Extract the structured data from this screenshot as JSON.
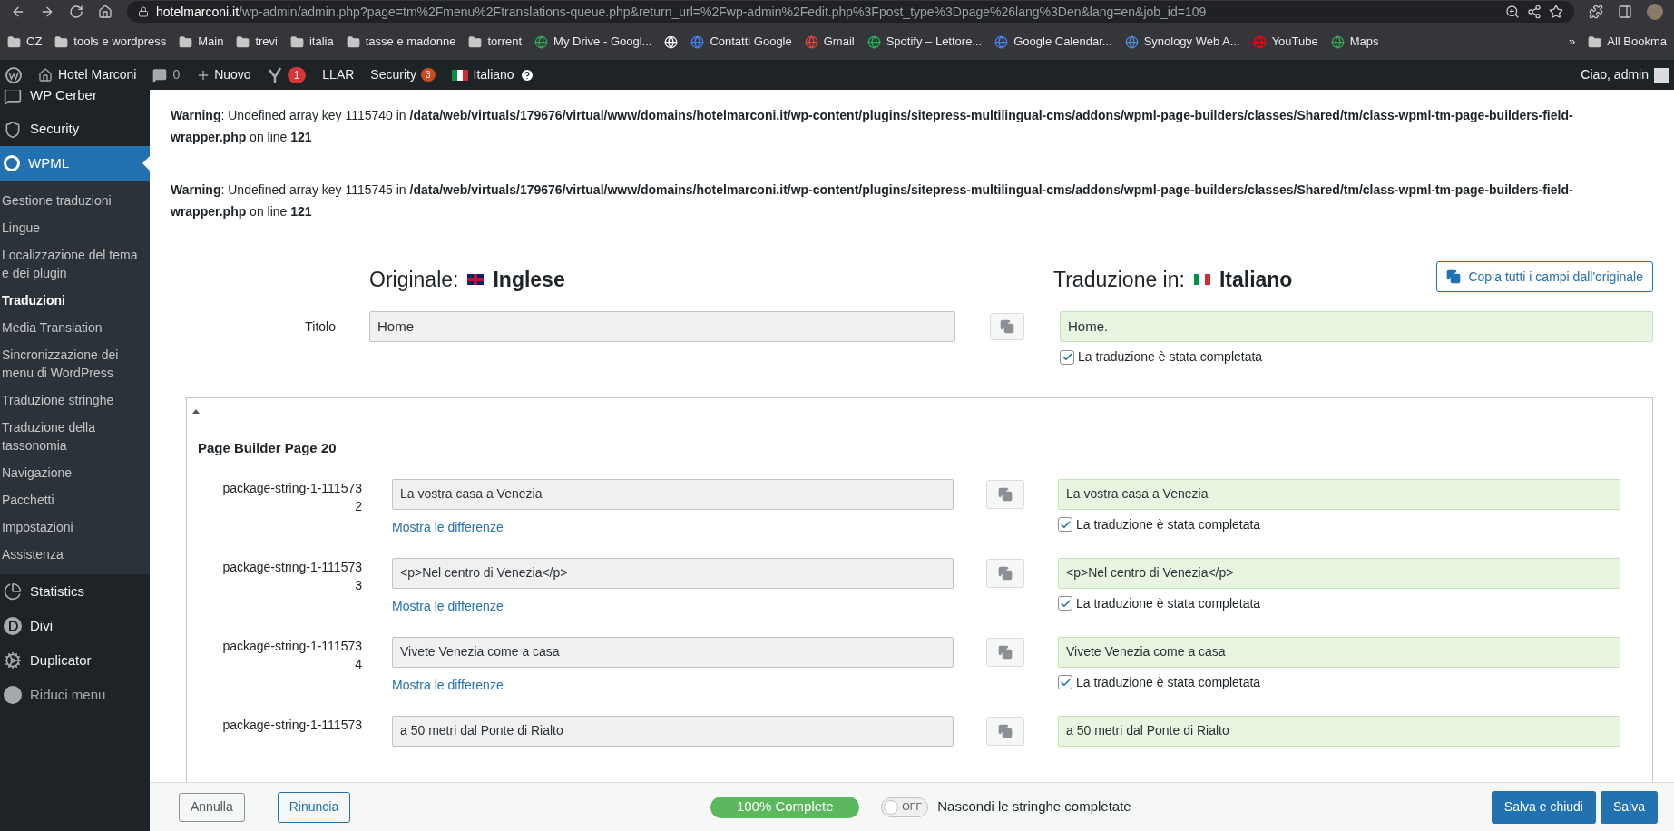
{
  "browser": {
    "url_host": "hotelmarconi.it",
    "url_path": "/wp-admin/admin.php?page=tm%2Fmenu%2Ftranslations-queue.php&return_url=%2Fwp-admin%2Fedit.php%3Fpost_type%3Dpage%26lang%3Den&lang=en&job_id=109"
  },
  "bookmarks": [
    {
      "kind": "folder",
      "label": "CZ"
    },
    {
      "kind": "folder",
      "label": "tools e wordpress"
    },
    {
      "kind": "folder",
      "label": "Main"
    },
    {
      "kind": "folder",
      "label": "trevi"
    },
    {
      "kind": "folder",
      "label": "italia"
    },
    {
      "kind": "folder",
      "label": "tasse e madonne"
    },
    {
      "kind": "folder",
      "label": "torrent"
    },
    {
      "kind": "site",
      "label": "My Drive - Googl...",
      "color": "#34a853"
    },
    {
      "kind": "site",
      "color": "#ffffff"
    },
    {
      "kind": "site",
      "label": "Contatti Google",
      "color": "#4285f4"
    },
    {
      "kind": "site",
      "label": "Gmail",
      "color": "#ea4335"
    },
    {
      "kind": "site",
      "label": "Spotify – Lettore...",
      "color": "#1db954"
    },
    {
      "kind": "site",
      "label": "Google Calendar...",
      "color": "#4285f4"
    },
    {
      "kind": "site",
      "label": "Synology Web A...",
      "color": "#4a90d9"
    },
    {
      "kind": "site",
      "label": "YouTube",
      "color": "#ff0000"
    },
    {
      "kind": "site",
      "label": "Maps",
      "color": "#34a853"
    }
  ],
  "bookmarks_more": "»",
  "bookmarks_all": "All Bookma",
  "admin_bar": {
    "site": "Hotel Marconi",
    "comments": "0",
    "new": "Nuovo",
    "yoast_badge": "1",
    "llar": "LLAR",
    "security": "Security",
    "security_badge": "3",
    "language": "Italiano",
    "greeting": "Ciao, admin"
  },
  "sidebar": {
    "top_items": [
      {
        "label": "WP Cerber"
      },
      {
        "label": "Security"
      }
    ],
    "current": {
      "label": "WPML",
      "selected": true
    },
    "submenu": [
      {
        "label": "Gestione traduzioni",
        "selected": false
      },
      {
        "label": "Lingue",
        "selected": false
      },
      {
        "label": "Localizzazione del tema e dei plugin",
        "selected": false
      },
      {
        "label": "Traduzioni",
        "selected": true
      },
      {
        "label": "Media Translation",
        "selected": false
      },
      {
        "label": "Sincronizzazione dei menu di WordPress",
        "selected": false
      },
      {
        "label": "Traduzione stringhe",
        "selected": false
      },
      {
        "label": "Traduzione della tassonomia",
        "selected": false
      },
      {
        "label": "Navigazione",
        "selected": false
      },
      {
        "label": "Pacchetti",
        "selected": false
      },
      {
        "label": "Impostazioni",
        "selected": false
      },
      {
        "label": "Assistenza",
        "selected": false
      }
    ],
    "bottom_items": [
      {
        "label": "Statistics"
      },
      {
        "label": "Divi"
      },
      {
        "label": "Duplicator"
      },
      {
        "label": "Riduci menu"
      }
    ]
  },
  "warnings": [
    {
      "text": "**Warning**: Undefined array key 1115740 in **/data/web/virtuals/179676/virtual/www/domains/hotelmarconi.it/wp-content/plugins/sitepress-multilingual-cms/addons/wpml-page-builders/classes/Shared/tm/class-wpml-tm-page-builders-field-wrapper.php** on line **121**"
    },
    {
      "text": "**Warning**: Undefined array key 1115745 in **/data/web/virtuals/179676/virtual/www/domains/hotelmarconi.it/wp-content/plugins/sitepress-multilingual-cms/addons/wpml-page-builders/classes/Shared/tm/class-wpml-tm-page-builders-field-wrapper.php** on line **121**"
    }
  ],
  "editor": {
    "original_label": "Originale:",
    "original_language": "Inglese",
    "translation_label": "Traduzione in:",
    "translation_language": "Italiano",
    "copy_all": "Copia tutti i campi dall'originale",
    "title_row": {
      "label": "Titolo",
      "original": "Home",
      "translation": "Home.",
      "completed": true,
      "completed_label": "La traduzione è stata completata"
    },
    "section": {
      "expanded": true,
      "title": "Page Builder Page 20",
      "rows": [
        {
          "label_lines": [
            "package-string-1-111573",
            "2"
          ],
          "original": "La vostra casa a Venezia",
          "diff_link": "Mostra le differenze",
          "translation": "La vostra casa a Venezia",
          "completed": true,
          "completed_label": "La traduzione è stata completata"
        },
        {
          "label_lines": [
            "package-string-1-111573",
            "3"
          ],
          "original": "<p>Nel centro di Venezia</p>",
          "diff_link": "Mostra le differenze",
          "translation": "<p>Nel centro di Venezia</p>",
          "completed": true,
          "completed_label": "La traduzione è stata completata"
        },
        {
          "label_lines": [
            "package-string-1-111573",
            "4"
          ],
          "original": "Vivete Venezia come a casa",
          "diff_link": "Mostra le differenze",
          "translation": "Vivete Venezia come a casa",
          "completed": true,
          "completed_label": "La traduzione è stata completata"
        },
        {
          "label_lines": [
            "package-string-1-111573"
          ],
          "original": "a 50 metri dal Ponte di Rialto",
          "translation": "a 50 metri dal Ponte di Rialto"
        }
      ]
    }
  },
  "footer": {
    "cancel": "Annulla",
    "resign": "Rinuncia",
    "progress": {
      "label": "100% Complete",
      "level": 1
    },
    "toggle": {
      "on": false,
      "label": "OFF"
    },
    "toggle_text": "Nascondi le stringhe completate",
    "save_close": "Salva e chiudi",
    "save": "Salva"
  }
}
